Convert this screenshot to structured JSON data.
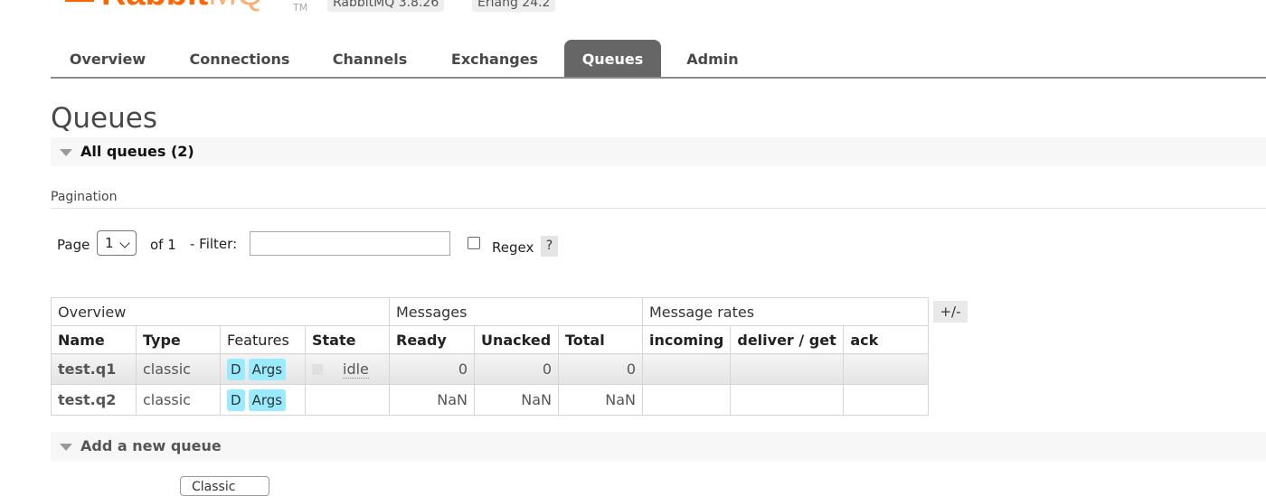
{
  "header": {
    "logo_primary": "Rabbit",
    "logo_secondary": "MQ",
    "logo_tm": "TM",
    "version_badge": "RabbitMQ 3.8.26",
    "erlang_badge": "Erlang 24.2"
  },
  "tabs": [
    {
      "label": "Overview",
      "active": false
    },
    {
      "label": "Connections",
      "active": false
    },
    {
      "label": "Channels",
      "active": false
    },
    {
      "label": "Exchanges",
      "active": false
    },
    {
      "label": "Queues",
      "active": true
    },
    {
      "label": "Admin",
      "active": false
    }
  ],
  "page_title": "Queues",
  "all_queues_section": {
    "label": "All queues (2)"
  },
  "pagination": {
    "label": "Pagination",
    "page_label": "Page",
    "page_value": "1",
    "of_text": "of 1",
    "filter_label": "- Filter:",
    "filter_value": "",
    "regex_label": "Regex",
    "regex_checked": false,
    "help_label": "?"
  },
  "table": {
    "groups": [
      "Overview",
      "Messages",
      "Message rates"
    ],
    "columns": [
      "Name",
      "Type",
      "Features",
      "State",
      "Ready",
      "Unacked",
      "Total",
      "incoming",
      "deliver / get",
      "ack"
    ],
    "rows": [
      {
        "name": "test.q1",
        "type": "classic",
        "features": [
          "D",
          "Args"
        ],
        "state": "idle",
        "ready": "0",
        "unacked": "0",
        "total": "0",
        "incoming": "",
        "deliver_get": "",
        "ack": ""
      },
      {
        "name": "test.q2",
        "type": "classic",
        "features": [
          "D",
          "Args"
        ],
        "state": "",
        "ready": "NaN",
        "unacked": "NaN",
        "total": "NaN",
        "incoming": "",
        "deliver_get": "",
        "ack": ""
      }
    ],
    "toggle_columns_label": "+/-"
  },
  "add_queue_section": {
    "label": "Add a new queue"
  },
  "add_queue_form": {
    "type_value": "Classic"
  },
  "colors": {
    "brand": "#ff6600",
    "active_tab": "#666666",
    "feature_tag": "#99ebff"
  }
}
